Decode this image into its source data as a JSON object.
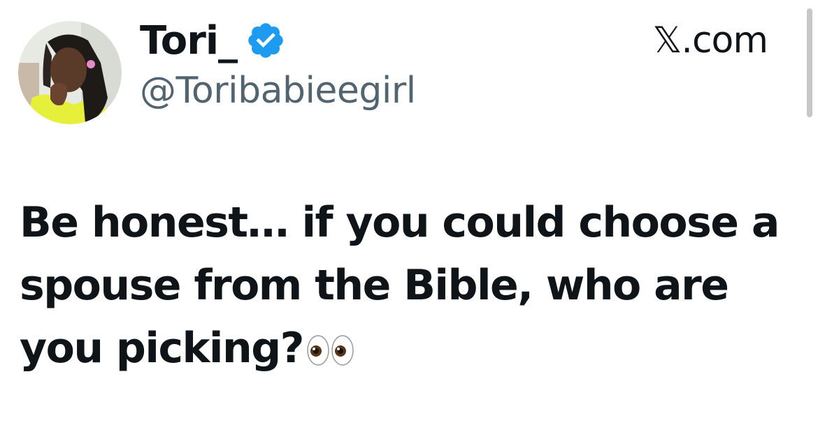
{
  "author": {
    "display_name": "Tori_",
    "handle": "@Toribabieegirl",
    "verified": true,
    "avatar_icon": "profile-photo"
  },
  "site": {
    "label": "𝕏.com"
  },
  "tweet": {
    "text": "Be honest… if you could choose a spouse from the Bible, who are you picking?",
    "emoji": "👀"
  },
  "colors": {
    "text_primary": "#0f1419",
    "text_secondary": "#536471",
    "verified_blue": "#1d9bf0"
  }
}
